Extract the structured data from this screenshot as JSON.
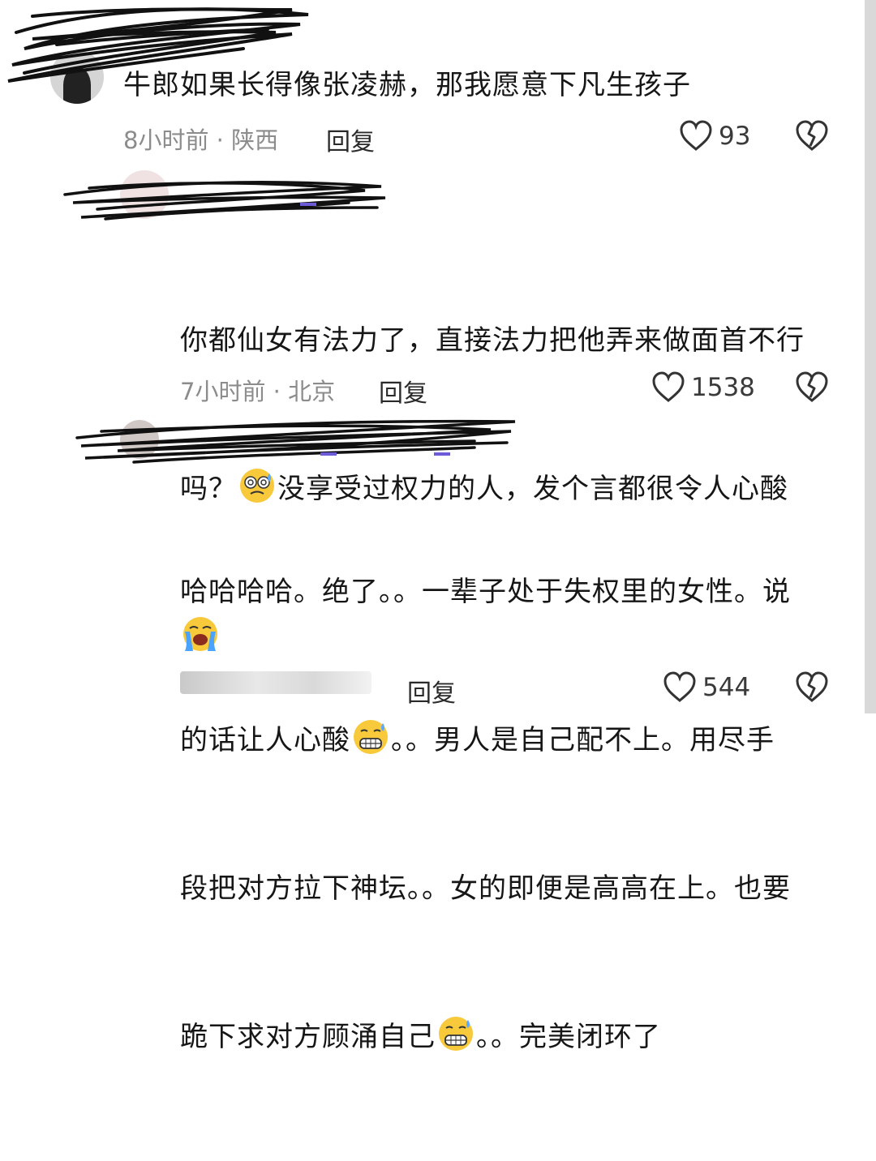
{
  "comments": [
    {
      "text": "牛郎如果长得像张凌赫，那我愿意下凡生孩子",
      "time_location": "8小时前 · 陕西",
      "reply_label": "回复",
      "likes": "93"
    },
    {
      "text_lines": [
        "你都仙女有法力了，直接法力把他弄来做面首不行",
        "吗？",
        "没享受过权力的人，发个言都很令人心酸"
      ],
      "time_location": "7小时前 · 北京",
      "reply_label": "回复",
      "likes": "1538"
    },
    {
      "lines": [
        "哈哈哈哈。绝了。。一辈子处于失权里的女性。说",
        "的话让人心酸",
        "。。男人是自己配不上。用尽手",
        "段把对方拉下神坛。。女的即便是高高在上。也要",
        "跪下求对方顾涌自己",
        "。。完美闭环了"
      ],
      "reply_label": "回复",
      "likes": "544"
    }
  ],
  "icons": {
    "like": "heart-outline-icon",
    "dislike": "broken-heart-icon",
    "emoji_1": "woozy-face-emoji",
    "emoji_2": "loudly-crying-face-emoji",
    "emoji_3": "grimacing-sweat-face-emoji"
  },
  "colors": {
    "text": "#161616",
    "meta": "#8c8c8c",
    "scribble": "#111111"
  }
}
